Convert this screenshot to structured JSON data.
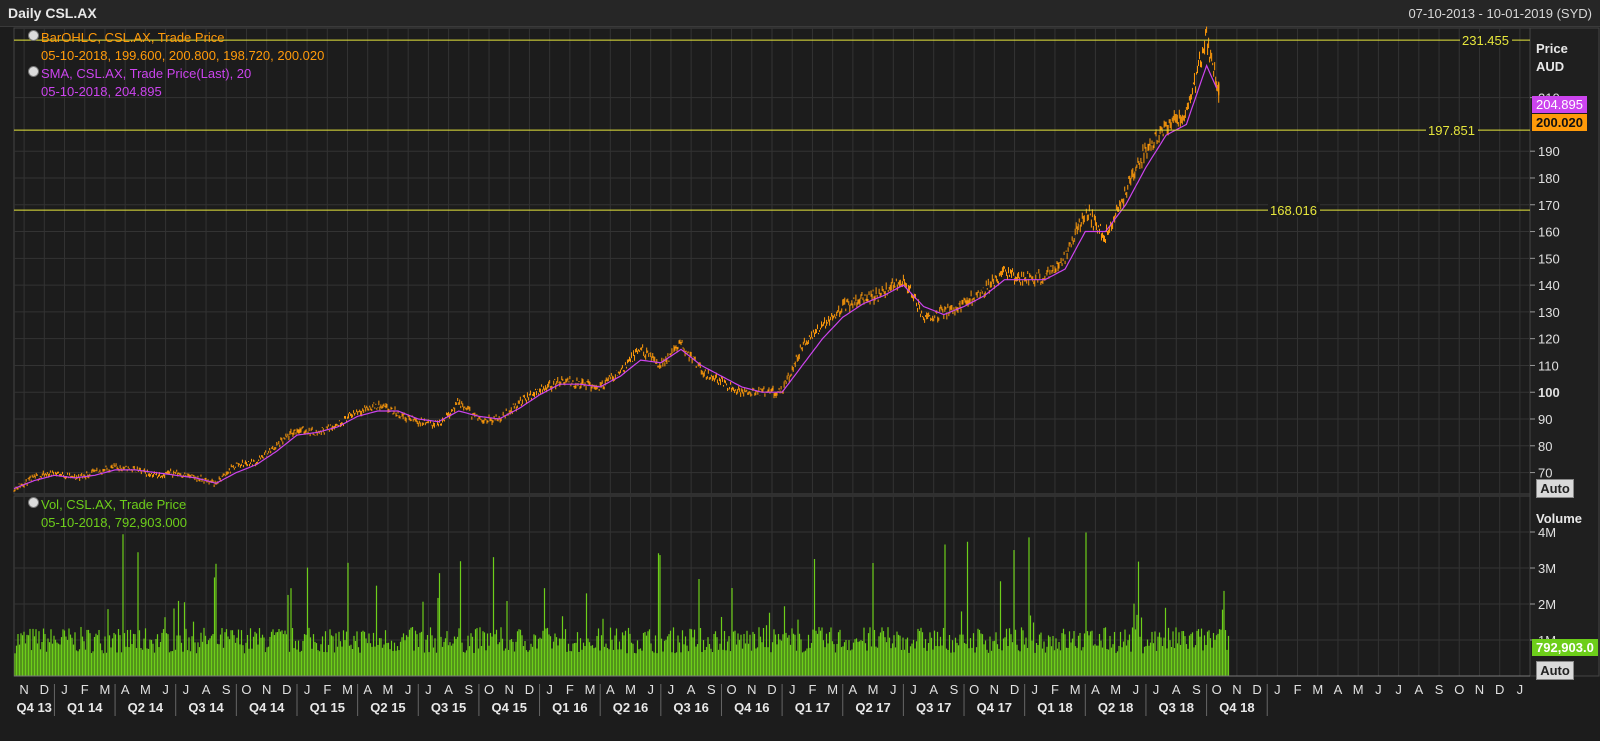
{
  "header": {
    "title": "Daily CSL.AX",
    "range": "07-10-2013 - 10-01-2019 (SYD)"
  },
  "legend": {
    "ohlc_name": "BarOHLC, CSL.AX, Trade Price",
    "ohlc_values": "05-10-2018, 199.600, 200.800, 198.720, 200.020",
    "sma_name": "SMA, CSL.AX, Trade Price(Last),  20",
    "sma_values": "05-10-2018, 204.895",
    "vol_name": "Vol, CSL.AX, Trade Price",
    "vol_values": "05-10-2018, 792,903.000"
  },
  "price_axis": {
    "title_line1": "Price",
    "title_line2": "AUD"
  },
  "volume_axis": {
    "title": "Volume"
  },
  "auto_label": "Auto",
  "tags": {
    "sma": "204.895",
    "last": "200.020",
    "volume": "792,903.0"
  },
  "colors": {
    "ohlc": "#ff9a0a",
    "sma": "#cc44ee",
    "volume": "#6dce1a",
    "hline": "#e6e63c",
    "background": "#1c1c1c"
  },
  "chart_data": {
    "type": "line",
    "price_ylim": [
      62,
      236
    ],
    "volume_ylim": [
      0,
      5000000
    ],
    "price_ticks": [
      {
        "v": 70,
        "t": "70"
      },
      {
        "v": 80,
        "t": "80"
      },
      {
        "v": 90,
        "t": "90"
      },
      {
        "v": 100,
        "t": "100",
        "b": true
      },
      {
        "v": 110,
        "t": "110"
      },
      {
        "v": 120,
        "t": "120"
      },
      {
        "v": 130,
        "t": "130"
      },
      {
        "v": 140,
        "t": "140"
      },
      {
        "v": 150,
        "t": "150"
      },
      {
        "v": 160,
        "t": "160"
      },
      {
        "v": 170,
        "t": "170"
      },
      {
        "v": 180,
        "t": "180"
      },
      {
        "v": 190,
        "t": "190"
      },
      {
        "v": 210,
        "t": "210"
      }
    ],
    "volume_ticks": [
      {
        "v": 1000000,
        "t": "1M"
      },
      {
        "v": 2000000,
        "t": "2M"
      },
      {
        "v": 3000000,
        "t": "3M"
      },
      {
        "v": 4000000,
        "t": "4M"
      }
    ],
    "months": [
      "N",
      "D",
      "J",
      "F",
      "M",
      "A",
      "M",
      "J",
      "J",
      "A",
      "S",
      "O",
      "N",
      "D",
      "J",
      "F",
      "M",
      "A",
      "M",
      "J",
      "J",
      "A",
      "S",
      "O",
      "N",
      "D",
      "J",
      "F",
      "M",
      "A",
      "M",
      "J",
      "J",
      "A",
      "S",
      "O",
      "N",
      "D",
      "J",
      "F",
      "M",
      "A",
      "M",
      "J",
      "J",
      "A",
      "S",
      "O",
      "N",
      "D",
      "J",
      "F",
      "M",
      "A",
      "M",
      "J",
      "J",
      "A",
      "S",
      "O",
      "N",
      "D",
      "J",
      "F",
      "M",
      "A",
      "M",
      "J",
      "J",
      "A",
      "S",
      "O",
      "N",
      "D",
      "J"
    ],
    "quarters": [
      "Q4 13",
      "Q1 14",
      "Q2 14",
      "Q3 14",
      "Q4 14",
      "Q1 15",
      "Q2 15",
      "Q3 15",
      "Q4 15",
      "Q1 16",
      "Q2 16",
      "Q3 16",
      "Q4 16",
      "Q1 17",
      "Q2 17",
      "Q3 17",
      "Q4 17",
      "Q1 18",
      "Q2 18",
      "Q3 18",
      "Q4 18"
    ],
    "horizontal_lines": [
      {
        "value": 231.455,
        "label": "231.455"
      },
      {
        "value": 197.851,
        "label": "197.851"
      },
      {
        "value": 168.016,
        "label": "168.016"
      }
    ],
    "price_series_month_index": [
      0,
      1,
      2,
      3,
      4,
      5,
      6,
      7,
      8,
      9,
      10,
      11,
      12,
      13,
      14,
      15,
      16,
      17,
      18,
      19,
      20,
      21,
      22,
      23,
      24,
      25,
      26,
      27,
      28,
      29,
      30,
      31,
      32,
      33,
      34,
      35,
      36,
      37,
      38,
      39,
      40,
      41,
      42,
      43,
      44,
      45,
      46,
      47,
      48,
      49,
      50,
      51,
      52,
      53,
      54,
      55,
      56,
      57,
      58,
      59,
      60,
      61,
      62,
      63
    ],
    "price_series": [
      64,
      68,
      70,
      68,
      70,
      72,
      71,
      69,
      70,
      68,
      66,
      73,
      74,
      80,
      86,
      85,
      88,
      93,
      95,
      92,
      89,
      88,
      96,
      90,
      90,
      96,
      101,
      104,
      103,
      102,
      108,
      116,
      110,
      118,
      108,
      104,
      100,
      100,
      100,
      117,
      125,
      132,
      135,
      137,
      142,
      128,
      130,
      133,
      138,
      145,
      142,
      143,
      150,
      168,
      158,
      175,
      190,
      200,
      203,
      232,
      201,
      0,
      0,
      0
    ],
    "sma_series": [
      64,
      67,
      69,
      68,
      69,
      71,
      71,
      70,
      69,
      68,
      66,
      70,
      73,
      78,
      84,
      85,
      87,
      91,
      93,
      93,
      90,
      89,
      93,
      91,
      90,
      94,
      99,
      103,
      103,
      102,
      106,
      112,
      111,
      116,
      110,
      106,
      102,
      100,
      100,
      110,
      120,
      128,
      133,
      136,
      140,
      132,
      129,
      132,
      136,
      142,
      142,
      142,
      146,
      160,
      160,
      170,
      184,
      196,
      200,
      222,
      205,
      0,
      0,
      0
    ],
    "volume_level": 1050000,
    "price_ohlc_last": {
      "date": "05-10-2018",
      "open": 199.6,
      "high": 200.8,
      "low": 198.72,
      "close": 200.02
    },
    "sma_last": {
      "date": "05-10-2018",
      "value": 204.895
    },
    "volume_last": {
      "date": "05-10-2018",
      "value": 792903
    }
  }
}
